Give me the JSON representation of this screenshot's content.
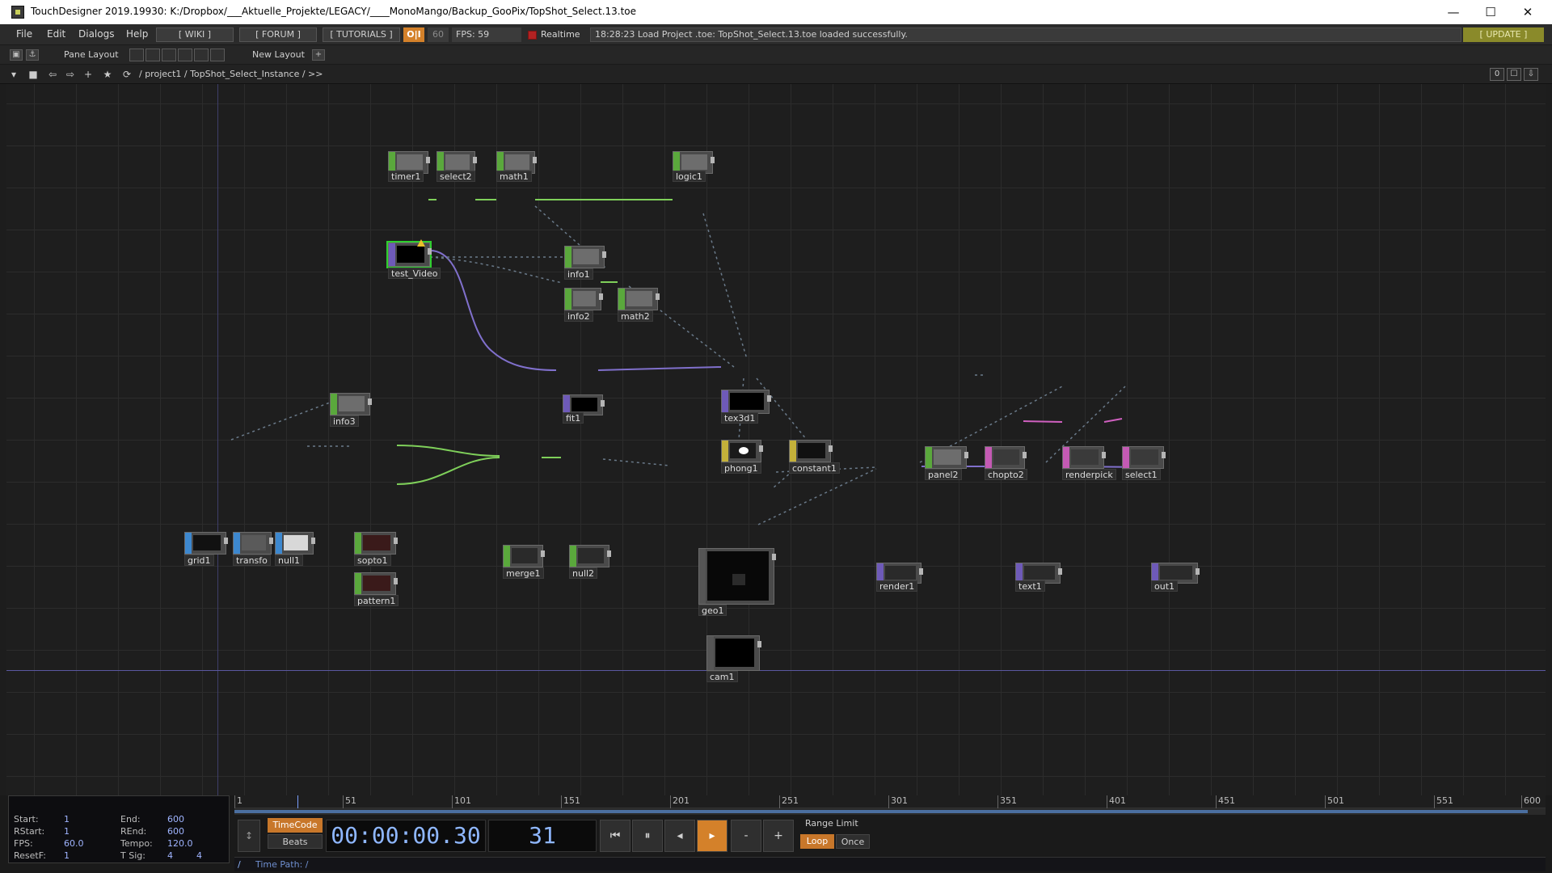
{
  "window": {
    "title": "TouchDesigner 2019.19930: K:/Dropbox/___Aktuelle_Projekte/LEGACY/____MonoMango/Backup_GooPix/TopShot_Select.13.toe",
    "minimize": "—",
    "maximize": "☐",
    "close": "✕"
  },
  "menu": {
    "items": [
      "File",
      "Edit",
      "Dialogs",
      "Help"
    ],
    "wiki": "[ WIKI ]",
    "forum": "[ FORUM ]",
    "tutorials": "[ TUTORIALS ]",
    "oi": "O|I",
    "fps_cap": "60",
    "fps": "FPS:  59",
    "realtime": "Realtime",
    "status": "18:28:23 Load Project .toe: TopShot_Select.13.toe loaded successfully.",
    "update": "[ UPDATE ]"
  },
  "panebar": {
    "pane_layout": "Pane Layout",
    "new_layout": "New Layout",
    "plus": "+"
  },
  "pathbar": {
    "path": "/  project1  /  TopShot_Select_Instance  /  >>",
    "right_value": "0"
  },
  "nodes": {
    "timer1": "timer1",
    "select2": "select2",
    "math1": "math1",
    "logic1": "logic1",
    "test_video": "test_Video",
    "info1": "info1",
    "info2": "info2",
    "math2": "math2",
    "fit1": "fit1",
    "tex3d1": "tex3d1",
    "panel2": "panel2",
    "chopto2": "chopto2",
    "renderpick": "renderpick",
    "select1": "select1",
    "info3": "info3",
    "phong1": "phong1",
    "constant1": "constant1",
    "grid1": "grid1",
    "transform": "transfo",
    "null1": "null1",
    "sopto1": "sopto1",
    "pattern1": "pattern1",
    "merge1": "merge1",
    "null2": "null2",
    "geo1": "geo1",
    "render1": "render1",
    "text1": "text1",
    "out1": "out1",
    "cam1": "cam1"
  },
  "timeline": {
    "start_label": "Start:",
    "start": "1",
    "end_label": "End:",
    "end": "600",
    "rstart_label": "RStart:",
    "rstart": "1",
    "rend_label": "REnd:",
    "rend": "600",
    "fps_label": "FPS:",
    "fps": "60.0",
    "tempo_label": "Tempo:",
    "tempo": "120.0",
    "resetf_label": "ResetF:",
    "resetf": "1",
    "tsig_label": "T Sig:",
    "tsig_a": "4",
    "tsig_b": "4",
    "ticks": [
      "1",
      "51",
      "101",
      "151",
      "201",
      "251",
      "301",
      "351",
      "401",
      "451",
      "501",
      "551",
      "600"
    ],
    "timecode_btn": "TimeCode",
    "beats_btn": "Beats",
    "timecode": "00:00:00.30",
    "frame": "31",
    "range_limit": "Range Limit",
    "loop": "Loop",
    "once": "Once",
    "time_path": "Time Path: /",
    "slash": "/"
  },
  "colors": {
    "chop": "#5aa83c",
    "top": "#6e5ab8",
    "sop": "#3d88cf",
    "mat": "#c4b13a",
    "dat": "#c45ab4",
    "accent": "#d4812a"
  }
}
